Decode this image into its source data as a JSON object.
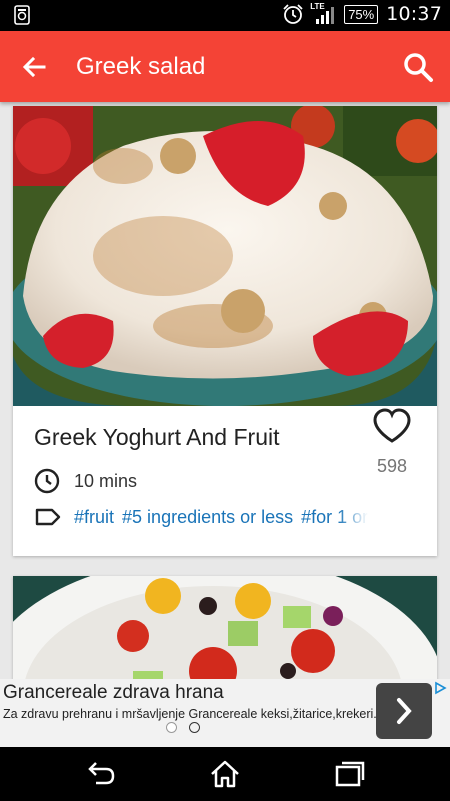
{
  "status_bar": {
    "network": "LTE",
    "battery": "75%",
    "time": "10:37"
  },
  "app_bar": {
    "title": "Greek salad",
    "color": "#f44336"
  },
  "recipes": [
    {
      "title": "Greek Yoghurt And Fruit",
      "likes": "598",
      "time": "10 mins",
      "tags": [
        "#fruit",
        "#5 ingredients or less",
        "#for 1 or"
      ]
    }
  ],
  "ad": {
    "title": "Grancereale zdrava hrana",
    "description": "Za zdravu prehranu i mršavljenje Grancereale keksi,žitarice,krekeri.",
    "next_icon": "chevron-right-icon",
    "page_indicator": {
      "count": 2,
      "active": 1
    }
  },
  "nav_bar": {
    "icons": [
      "back-icon",
      "home-icon",
      "recent-apps-icon"
    ]
  }
}
